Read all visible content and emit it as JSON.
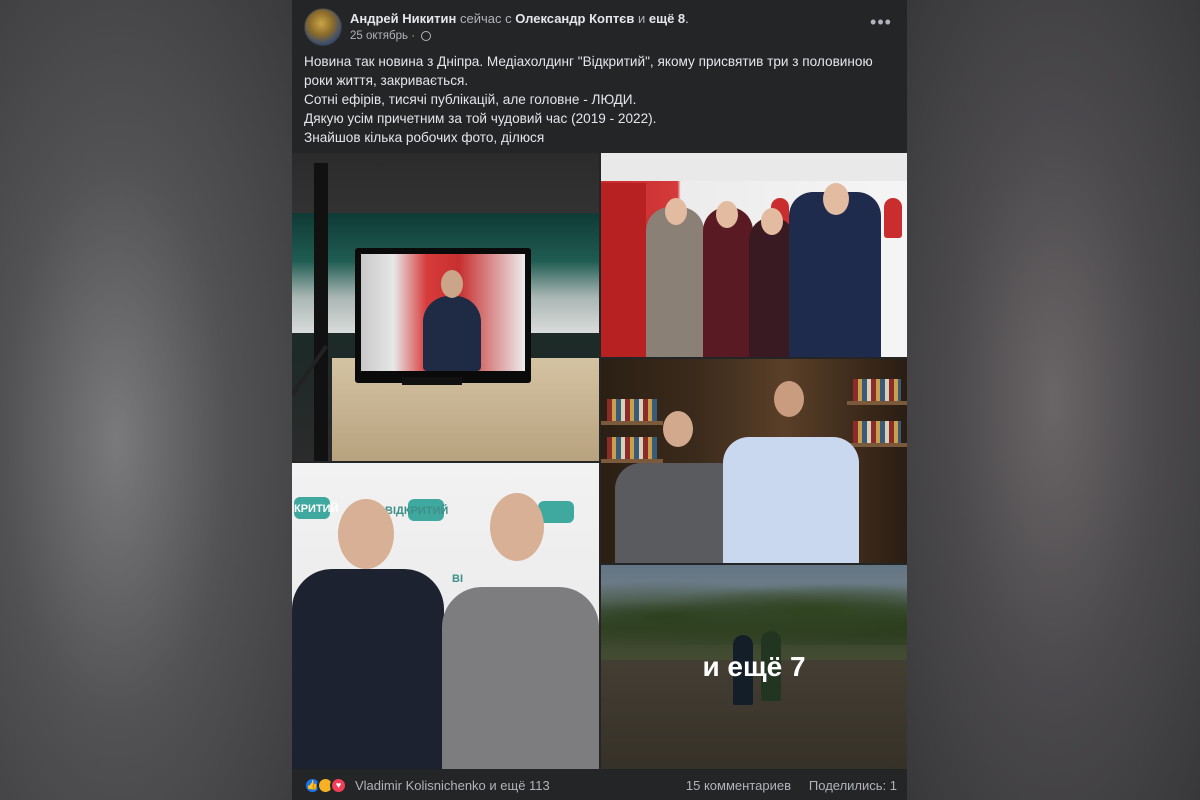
{
  "post": {
    "author": "Андрей Никитин",
    "with_prefix": "сейчас с",
    "tagged": "Олександр Коптєв",
    "and_word": "и",
    "others": "ещё 8",
    "period": ".",
    "date": "25 октябрь",
    "privacy_icon": "globe-icon",
    "more_icon": "more-horizontal-icon",
    "text_lines": [
      "Новина так новина з Дніпра. Медіахолдинг \"Відкритий\", якому присвятив три з половиною",
      "роки життя, закривається.",
      "Сотні ефірів, тисячі публікацій, але головне - ЛЮДИ.",
      "Дякую усім причетним за той чудовий час (2019 - 2022).",
      "Знайшов кілька робочих фото, ділюся"
    ]
  },
  "photos": {
    "count": 5,
    "more_overlay": "и ещё 7",
    "logo_text_1": "ВІДКРИТИЙ",
    "logo_text_2": "КРИТИЙ",
    "logo_text_3": "ВІ"
  },
  "footer": {
    "reactions": [
      "like",
      "care",
      "love"
    ],
    "reactors": "Vladimir Kolisnichenko и ещё 113",
    "comments": "15 комментариев",
    "shares": "Поделились: 1"
  },
  "colors": {
    "card_bg": "#242526",
    "text_primary": "#e4e6eb",
    "text_secondary": "#b0b3b8",
    "like_blue": "#1877f2",
    "love_red": "#f33e58",
    "care_yellow": "#f7b125"
  }
}
